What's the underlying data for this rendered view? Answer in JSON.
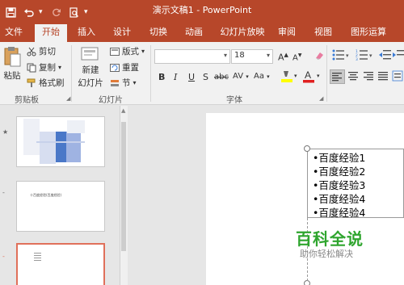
{
  "window": {
    "title": "演示文稿1 - PowerPoint"
  },
  "qat": {
    "save_icon": "save-icon",
    "undo_icon": "undo-icon",
    "redo_icon": "redo-icon",
    "preview_icon": "print-preview-icon"
  },
  "tabs": [
    {
      "label": "文件"
    },
    {
      "label": "开始"
    },
    {
      "label": "插入"
    },
    {
      "label": "设计"
    },
    {
      "label": "切换"
    },
    {
      "label": "动画"
    },
    {
      "label": "幻灯片放映"
    },
    {
      "label": "审阅"
    },
    {
      "label": "视图"
    },
    {
      "label": "图形运算"
    }
  ],
  "active_tab": "开始",
  "ribbon": {
    "clipboard": {
      "paste": "粘贴",
      "cut": "剪切",
      "copy": "复制",
      "format_painter": "格式刷",
      "group": "剪贴板"
    },
    "slides": {
      "new_slide_line1": "新建",
      "new_slide_line2": "幻灯片",
      "layout": "版式",
      "reset": "重置",
      "section": "节",
      "group": "幻灯片"
    },
    "font": {
      "font_name": "",
      "font_size": "18",
      "group": "字体",
      "buttons": [
        "B",
        "I",
        "U",
        "S",
        "abc",
        "AV",
        "Aa"
      ]
    }
  },
  "slides_pane": {
    "thumb2_text": "十百度经验(百度经验)"
  },
  "slide": {
    "bullets": [
      "•百度经验1",
      "•百度经验2",
      "•百度经验3",
      "•百度经验4",
      "•百度经验4"
    ]
  },
  "watermark": {
    "title": "百科全说",
    "subtitle": "助你轻松解决"
  },
  "colors": {
    "accent": "#b7472a",
    "watermark": "#2fa52e",
    "selection": "#e0705a"
  }
}
